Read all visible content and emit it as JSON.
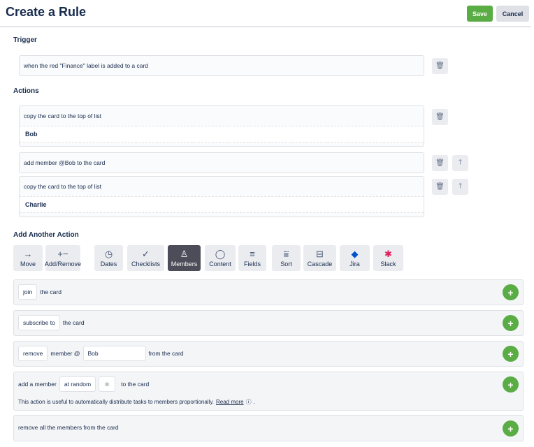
{
  "header": {
    "title": "Create a Rule",
    "save": "Save",
    "cancel": "Cancel"
  },
  "trigger": {
    "label": "Trigger",
    "text": "when the red \"Finance\" label is added to a card"
  },
  "actions": {
    "label": "Actions",
    "items": [
      {
        "text": "copy the card to the top of list",
        "sub": "Bob"
      },
      {
        "text": "add member @Bob to the card"
      },
      {
        "text": "copy the card to the top of list",
        "sub": "Charlie"
      }
    ]
  },
  "add_action": {
    "label": "Add Another Action",
    "tabs": [
      {
        "label": "Move",
        "icon": "→"
      },
      {
        "label": "Add/Remove",
        "icon": "+−"
      },
      {
        "label": "Dates",
        "icon": "◷"
      },
      {
        "label": "Checklists",
        "icon": "✓"
      },
      {
        "label": "Members",
        "icon": "♙"
      },
      {
        "label": "Content",
        "icon": "◯"
      },
      {
        "label": "Fields",
        "icon": "≡"
      },
      {
        "label": "Sort",
        "icon": "⩸"
      },
      {
        "label": "Cascade",
        "icon": "⊟"
      },
      {
        "label": "Jira",
        "icon": "◆"
      },
      {
        "label": "Slack",
        "icon": "✱"
      }
    ]
  },
  "sections": {
    "join": {
      "chip": "join",
      "text": "the card"
    },
    "subscribe": {
      "chip": "subscribe to",
      "text": "the card"
    },
    "remove": {
      "chip": "remove",
      "mid": "member @",
      "value": "Bob",
      "text": "from the card"
    },
    "add": {
      "pre": "add a member",
      "chip": "at random",
      "text": "to the card",
      "help": "This action is useful to automatically distribute tasks to members proportionally.",
      "link": "Read more",
      "end": "."
    },
    "remove_all": {
      "text": "remove all the members from the card"
    }
  },
  "colors": {
    "accent": "#5aac44",
    "active_tab": "#4d4d59"
  }
}
